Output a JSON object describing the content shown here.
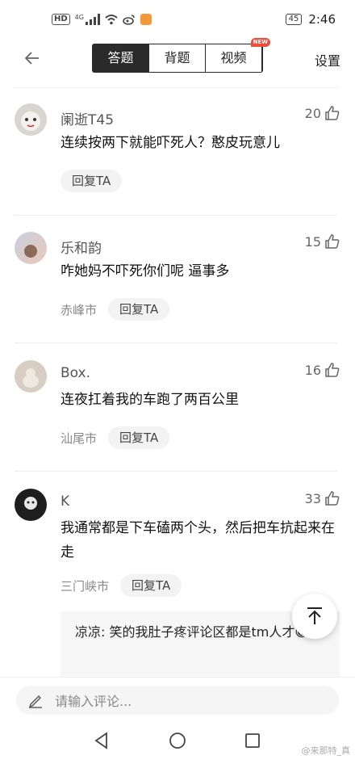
{
  "status_bar": {
    "left_badge": "HD",
    "network": "4G",
    "battery": "45",
    "time": "2:46"
  },
  "header": {
    "tabs": [
      {
        "label": "答题",
        "active": true
      },
      {
        "label": "背题",
        "active": false
      },
      {
        "label": "视频",
        "active": false
      }
    ],
    "new_badge": "NEW",
    "settings_label": "设置"
  },
  "comments": [
    {
      "name": "阑逝T45",
      "likes": "20",
      "text": "连续按两下就能吓死人？憨皮玩意儿",
      "location": "",
      "reply_label": "回复TA",
      "avatar_color": "#d9d6d2"
    },
    {
      "name": "乐和韵",
      "likes": "15",
      "text": "咋她妈不吓死你们呢 逼事多",
      "location": "赤峰市",
      "reply_label": "回复TA",
      "avatar_color": "#b9c2d6"
    },
    {
      "name": "Box.",
      "likes": "16",
      "text": "连夜扛着我的车跑了两百公里",
      "location": "汕尾市",
      "reply_label": "回复TA",
      "avatar_color": "#c9bfb5"
    },
    {
      "name": "K",
      "likes": "33",
      "text": "我通常都是下车磕两个头，然后把车抗起来在走",
      "location": "三门峡市",
      "reply_label": "回复TA",
      "avatar_color": "#2b2b2b"
    }
  ],
  "sub_reply": {
    "text": "凉凉: 笑的我肚子疼评论区都是tm人才😁"
  },
  "input": {
    "placeholder": "请输入评论..."
  },
  "watermark": "@来那特_真",
  "colors": {
    "accent_dark": "#2a2a2a",
    "new_badge": "#f04b3b"
  }
}
